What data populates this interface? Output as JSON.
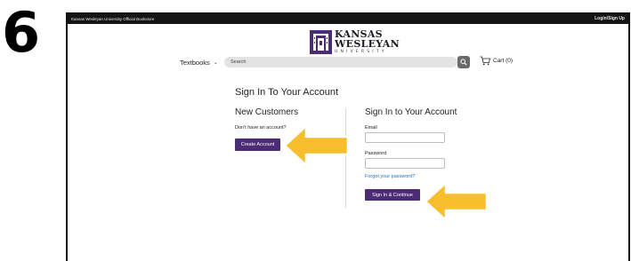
{
  "step_number": "6",
  "topbar": {
    "store_name": "Kansas Wesleyan University Official Bookstore",
    "login_label": "Login/Sign Up"
  },
  "logo": {
    "line1": "KANSAS",
    "line2": "WESLEYAN",
    "line3": "UNIVERSITY"
  },
  "nav": {
    "textbooks_label": "Textbooks",
    "search_placeholder": "Search",
    "cart_label": "Cart (0)"
  },
  "page": {
    "title": "Sign In To Your Account"
  },
  "new_customers": {
    "title": "New Customers",
    "prompt": "Don't have an account?",
    "create_button": "Create Account"
  },
  "sign_in": {
    "title": "Sign In to Your Account",
    "email_label": "Email",
    "email_value": "",
    "password_label": "Password",
    "password_value": "",
    "forgot_link": "Forgot your password?",
    "submit_button": "Sign In & Continue"
  },
  "colors": {
    "brand_purple": "#4c2c74",
    "callout_arrow": "#f7bf2e",
    "link_blue": "#1a73c8"
  }
}
